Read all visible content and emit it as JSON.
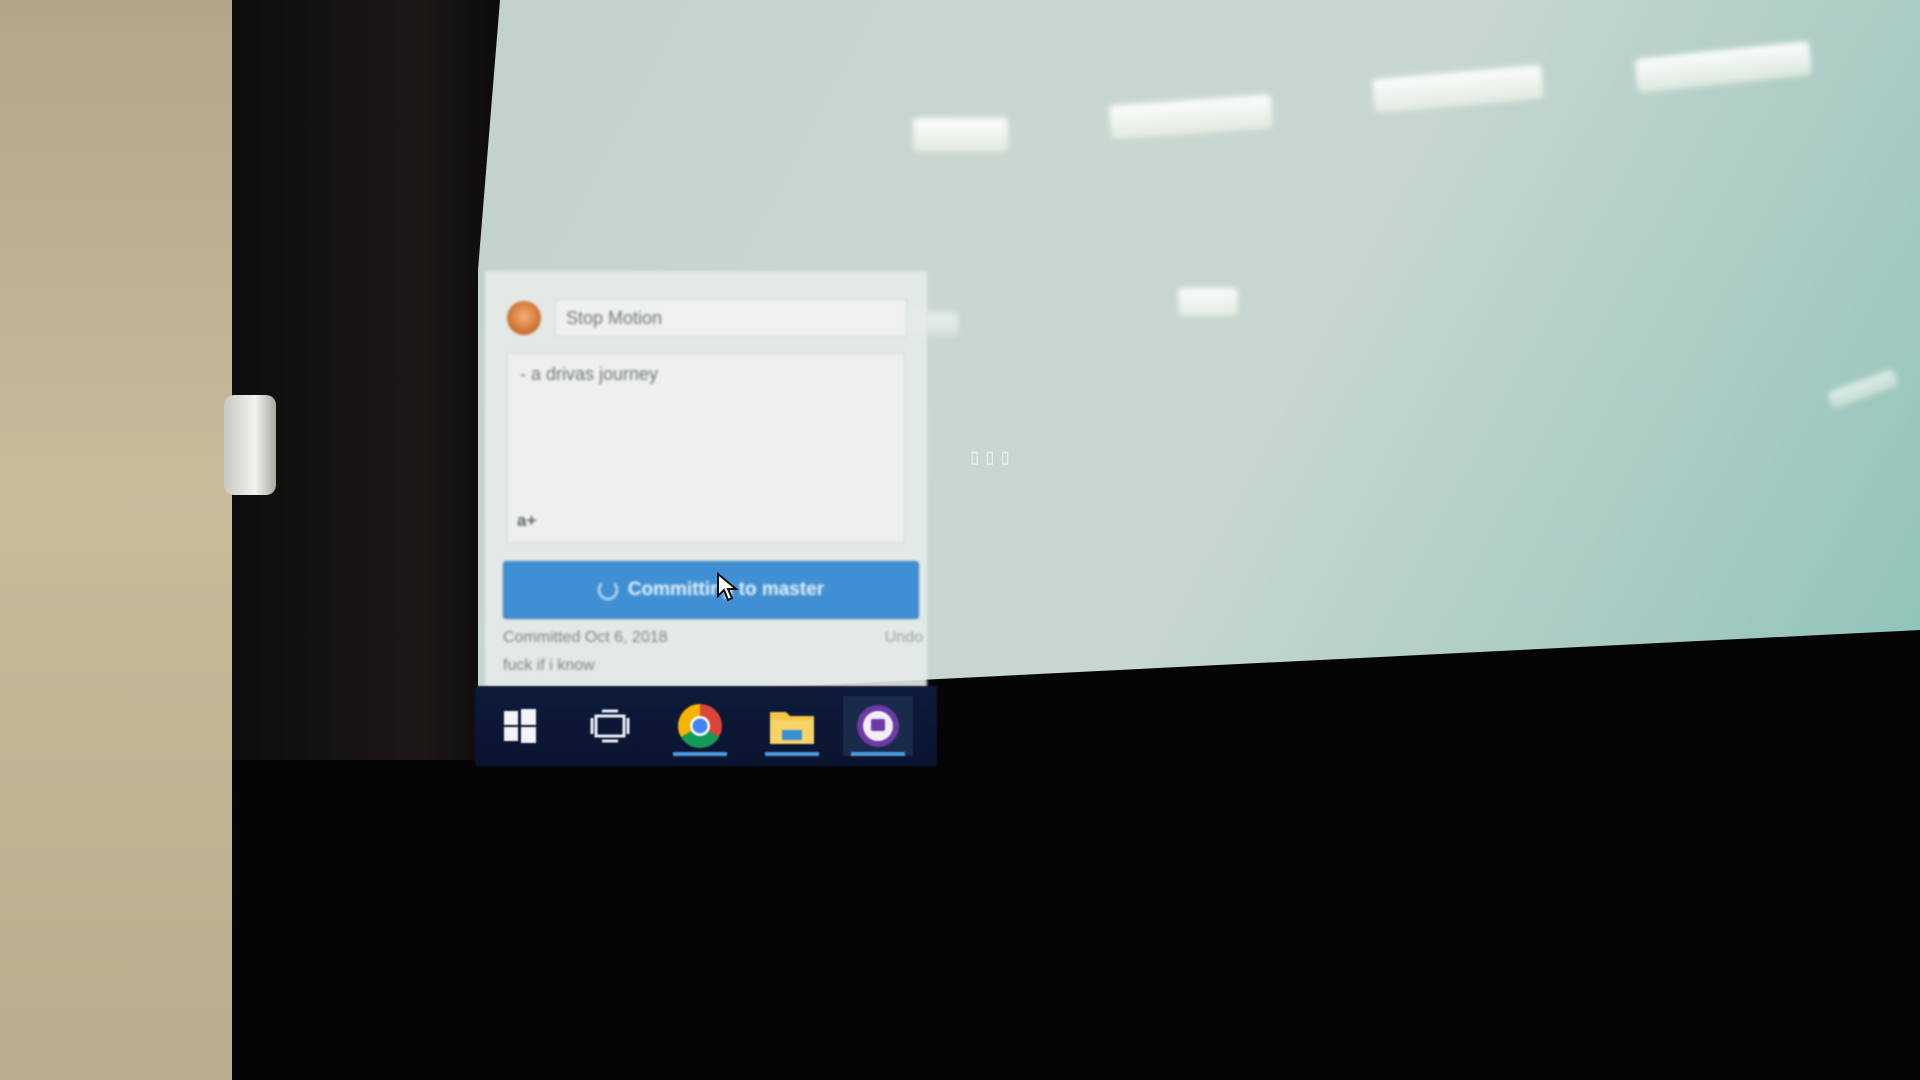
{
  "commit_panel": {
    "summary": "Stop Motion",
    "description": "- a drivas journey",
    "coauthor_label": "a+",
    "commit_button_label": "Committing to master",
    "last_commit": {
      "committed_label": "Committed Oct 6, 2018",
      "undo_label": "Undo",
      "message": "fuck if i know"
    }
  },
  "taskbar": {
    "items": [
      {
        "name": "start",
        "icon": "windows-logo-icon",
        "active": false
      },
      {
        "name": "task-view",
        "icon": "task-view-icon",
        "active": false
      },
      {
        "name": "chrome",
        "icon": "chrome-icon",
        "active": true
      },
      {
        "name": "file-explorer",
        "icon": "folder-icon",
        "active": true
      },
      {
        "name": "app",
        "icon": "purple-app-icon",
        "active": true
      }
    ]
  },
  "colors": {
    "commit_button": "#3f8fd2",
    "taskbar": "#0d1a3a",
    "taskbar_indicator": "#4b9be0",
    "desktop": "#c6d6d0"
  }
}
